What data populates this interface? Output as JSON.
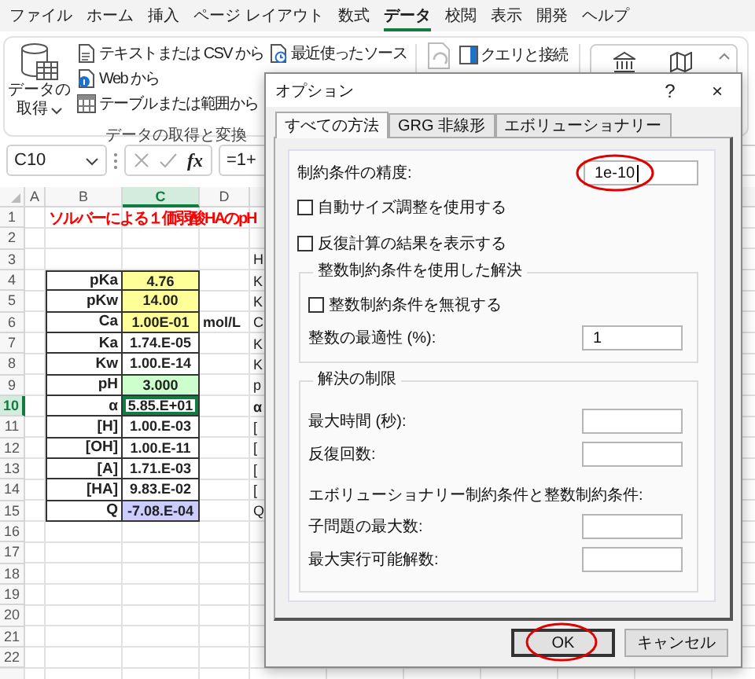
{
  "menu_tabs": [
    {
      "label": "ファイル",
      "selected": false
    },
    {
      "label": "ホーム",
      "selected": false
    },
    {
      "label": "挿入",
      "selected": false
    },
    {
      "label": "ページ レイアウト",
      "selected": false
    },
    {
      "label": "数式",
      "selected": false
    },
    {
      "label": "データ",
      "selected": true
    },
    {
      "label": "校閲",
      "selected": false
    },
    {
      "label": "表示",
      "selected": false
    },
    {
      "label": "開発",
      "selected": false
    },
    {
      "label": "ヘルプ",
      "selected": false
    }
  ],
  "ribbon": {
    "get_transform_group": {
      "label": "データの取得と変換",
      "get_data_button": {
        "lines": [
          "データの",
          "取得"
        ]
      },
      "buttons": [
        {
          "kind": "text",
          "label": "テキストまたは CSV から"
        },
        {
          "kind": "web",
          "label": "Web から"
        },
        {
          "kind": "table",
          "label": "テーブルまたは範囲から"
        },
        {
          "kind": "recent",
          "label": "最近使ったソース"
        }
      ]
    },
    "queries_group": {
      "buttons": [
        {
          "kind": "queries",
          "label": "クエリと接続"
        }
      ]
    }
  },
  "formula_bar": {
    "name_box": "C10",
    "function_label": "fx",
    "formula": "=1+"
  },
  "sheet": {
    "columns": [
      {
        "label": "A",
        "selected": false
      },
      {
        "label": "B",
        "selected": false
      },
      {
        "label": "C",
        "selected": true
      },
      {
        "label": "D",
        "selected": false
      }
    ],
    "row_numbers": [
      {
        "label": "1",
        "selected": false
      },
      {
        "label": "2",
        "selected": false
      },
      {
        "label": "3",
        "selected": false
      },
      {
        "label": "4",
        "selected": false
      },
      {
        "label": "5",
        "selected": false
      },
      {
        "label": "6",
        "selected": false
      },
      {
        "label": "7",
        "selected": false
      },
      {
        "label": "8",
        "selected": false
      },
      {
        "label": "9",
        "selected": false
      },
      {
        "label": "10",
        "selected": true
      },
      {
        "label": "11",
        "selected": false
      },
      {
        "label": "12",
        "selected": false
      },
      {
        "label": "13",
        "selected": false
      },
      {
        "label": "14",
        "selected": false
      },
      {
        "label": "15",
        "selected": false
      },
      {
        "label": "16",
        "selected": false
      },
      {
        "label": "17",
        "selected": false
      },
      {
        "label": "18",
        "selected": false
      },
      {
        "label": "19",
        "selected": false
      },
      {
        "label": "20",
        "selected": false
      },
      {
        "label": "21",
        "selected": false
      },
      {
        "label": "22",
        "selected": false
      }
    ],
    "title": "ソルバーによる１価弱酸HAのpH",
    "table": [
      {
        "label": "pKa",
        "value": "4.76",
        "color": "#ffff99",
        "selected": false
      },
      {
        "label": "pKw",
        "value": "14.00",
        "color": "#ffff99",
        "selected": false
      },
      {
        "label": "Ca",
        "value": "1.00E-01",
        "color": "#ffff99",
        "selected": false,
        "unit": "mol/L"
      },
      {
        "label": "Ka",
        "value": "1.74.E-05",
        "color": "#ffffff",
        "selected": false
      },
      {
        "label": "Kw",
        "value": "1.00.E-14",
        "color": "#ffffff",
        "selected": false
      },
      {
        "label": "pH",
        "value": "3.000",
        "color": "#ccffcc",
        "selected": false
      },
      {
        "label": "α",
        "value": "5.85.E+01",
        "color": "#ffffff",
        "selected": true
      },
      {
        "label": "[H]",
        "value": "1.00.E-03",
        "color": "#ffffff",
        "selected": false
      },
      {
        "label": "[OH]",
        "value": "1.00.E-11",
        "color": "#ffffff",
        "selected": false
      },
      {
        "label": "[A]",
        "value": "1.71.E-03",
        "color": "#ffffff",
        "selected": false
      },
      {
        "label": "[HA]",
        "value": "9.83.E-02",
        "color": "#ffffff",
        "selected": false
      },
      {
        "label": "Q",
        "value": "-7.08.E-04",
        "color": "#ccccff",
        "selected": false
      }
    ],
    "column_5": [
      {
        "text": "H",
        "bold": false
      },
      {
        "text": "K",
        "bold": false
      },
      {
        "text": "K",
        "bold": false
      },
      {
        "text": "C",
        "bold": false
      },
      {
        "text": "K",
        "bold": false
      },
      {
        "text": "K",
        "bold": false
      },
      {
        "text": "p",
        "bold": false
      },
      {
        "text": "α",
        "bold": true
      },
      {
        "text": "[",
        "bold": false
      },
      {
        "text": "[",
        "bold": false
      },
      {
        "text": "[",
        "bold": false
      },
      {
        "text": "[",
        "bold": false
      },
      {
        "text": "Q",
        "bold": false
      }
    ]
  },
  "dialog": {
    "title": "オプション",
    "help_button": "?",
    "close_button": "×",
    "tabs": [
      {
        "label": "すべての方法",
        "selected": true
      },
      {
        "label": "GRG 非線形",
        "selected": false
      },
      {
        "label": "エボリューショナリー",
        "selected": false
      }
    ],
    "precision": {
      "label": "制約条件の精度:",
      "value": "1e-10",
      "focused": true,
      "highlighted": true
    },
    "checkboxes": [
      {
        "label": "自動サイズ調整を使用する",
        "checked": false
      },
      {
        "label": "反復計算の結果を表示する",
        "checked": false
      }
    ],
    "integer_group": {
      "title": "整数制約条件を使用した解決",
      "checkboxes": [
        {
          "label": "整数制約条件を無視する",
          "checked": false
        }
      ],
      "optimality": {
        "label": "整数の最適性 (%):",
        "value": "1"
      }
    },
    "limits_group": {
      "title": "解決の制限",
      "items": [
        {
          "kind": "field",
          "label": "最大時間 (秒):"
        },
        {
          "kind": "field",
          "label": "反復回数:"
        },
        {
          "kind": "note",
          "label": "エボリューショナリー制約条件と整数制約条件:"
        },
        {
          "kind": "field",
          "label": "子問題の最大数:"
        },
        {
          "kind": "field",
          "label": "最大実行可能解数:"
        }
      ]
    },
    "buttons": [
      {
        "label": "OK",
        "default": true,
        "highlighted": true
      },
      {
        "label": "キャンセル",
        "default": false,
        "highlighted": false
      }
    ]
  }
}
